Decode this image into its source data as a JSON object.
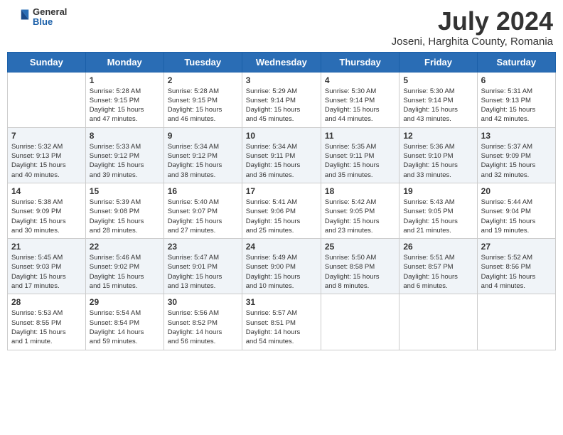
{
  "header": {
    "logo_general": "General",
    "logo_blue": "Blue",
    "month_year": "July 2024",
    "location": "Joseni, Harghita County, Romania"
  },
  "weekdays": [
    "Sunday",
    "Monday",
    "Tuesday",
    "Wednesday",
    "Thursday",
    "Friday",
    "Saturday"
  ],
  "weeks": [
    [
      {
        "day": "",
        "content": ""
      },
      {
        "day": "1",
        "content": "Sunrise: 5:28 AM\nSunset: 9:15 PM\nDaylight: 15 hours\nand 47 minutes."
      },
      {
        "day": "2",
        "content": "Sunrise: 5:28 AM\nSunset: 9:15 PM\nDaylight: 15 hours\nand 46 minutes."
      },
      {
        "day": "3",
        "content": "Sunrise: 5:29 AM\nSunset: 9:14 PM\nDaylight: 15 hours\nand 45 minutes."
      },
      {
        "day": "4",
        "content": "Sunrise: 5:30 AM\nSunset: 9:14 PM\nDaylight: 15 hours\nand 44 minutes."
      },
      {
        "day": "5",
        "content": "Sunrise: 5:30 AM\nSunset: 9:14 PM\nDaylight: 15 hours\nand 43 minutes."
      },
      {
        "day": "6",
        "content": "Sunrise: 5:31 AM\nSunset: 9:13 PM\nDaylight: 15 hours\nand 42 minutes."
      }
    ],
    [
      {
        "day": "7",
        "content": "Sunrise: 5:32 AM\nSunset: 9:13 PM\nDaylight: 15 hours\nand 40 minutes."
      },
      {
        "day": "8",
        "content": "Sunrise: 5:33 AM\nSunset: 9:12 PM\nDaylight: 15 hours\nand 39 minutes."
      },
      {
        "day": "9",
        "content": "Sunrise: 5:34 AM\nSunset: 9:12 PM\nDaylight: 15 hours\nand 38 minutes."
      },
      {
        "day": "10",
        "content": "Sunrise: 5:34 AM\nSunset: 9:11 PM\nDaylight: 15 hours\nand 36 minutes."
      },
      {
        "day": "11",
        "content": "Sunrise: 5:35 AM\nSunset: 9:11 PM\nDaylight: 15 hours\nand 35 minutes."
      },
      {
        "day": "12",
        "content": "Sunrise: 5:36 AM\nSunset: 9:10 PM\nDaylight: 15 hours\nand 33 minutes."
      },
      {
        "day": "13",
        "content": "Sunrise: 5:37 AM\nSunset: 9:09 PM\nDaylight: 15 hours\nand 32 minutes."
      }
    ],
    [
      {
        "day": "14",
        "content": "Sunrise: 5:38 AM\nSunset: 9:09 PM\nDaylight: 15 hours\nand 30 minutes."
      },
      {
        "day": "15",
        "content": "Sunrise: 5:39 AM\nSunset: 9:08 PM\nDaylight: 15 hours\nand 28 minutes."
      },
      {
        "day": "16",
        "content": "Sunrise: 5:40 AM\nSunset: 9:07 PM\nDaylight: 15 hours\nand 27 minutes."
      },
      {
        "day": "17",
        "content": "Sunrise: 5:41 AM\nSunset: 9:06 PM\nDaylight: 15 hours\nand 25 minutes."
      },
      {
        "day": "18",
        "content": "Sunrise: 5:42 AM\nSunset: 9:05 PM\nDaylight: 15 hours\nand 23 minutes."
      },
      {
        "day": "19",
        "content": "Sunrise: 5:43 AM\nSunset: 9:05 PM\nDaylight: 15 hours\nand 21 minutes."
      },
      {
        "day": "20",
        "content": "Sunrise: 5:44 AM\nSunset: 9:04 PM\nDaylight: 15 hours\nand 19 minutes."
      }
    ],
    [
      {
        "day": "21",
        "content": "Sunrise: 5:45 AM\nSunset: 9:03 PM\nDaylight: 15 hours\nand 17 minutes."
      },
      {
        "day": "22",
        "content": "Sunrise: 5:46 AM\nSunset: 9:02 PM\nDaylight: 15 hours\nand 15 minutes."
      },
      {
        "day": "23",
        "content": "Sunrise: 5:47 AM\nSunset: 9:01 PM\nDaylight: 15 hours\nand 13 minutes."
      },
      {
        "day": "24",
        "content": "Sunrise: 5:49 AM\nSunset: 9:00 PM\nDaylight: 15 hours\nand 10 minutes."
      },
      {
        "day": "25",
        "content": "Sunrise: 5:50 AM\nSunset: 8:58 PM\nDaylight: 15 hours\nand 8 minutes."
      },
      {
        "day": "26",
        "content": "Sunrise: 5:51 AM\nSunset: 8:57 PM\nDaylight: 15 hours\nand 6 minutes."
      },
      {
        "day": "27",
        "content": "Sunrise: 5:52 AM\nSunset: 8:56 PM\nDaylight: 15 hours\nand 4 minutes."
      }
    ],
    [
      {
        "day": "28",
        "content": "Sunrise: 5:53 AM\nSunset: 8:55 PM\nDaylight: 15 hours\nand 1 minute."
      },
      {
        "day": "29",
        "content": "Sunrise: 5:54 AM\nSunset: 8:54 PM\nDaylight: 14 hours\nand 59 minutes."
      },
      {
        "day": "30",
        "content": "Sunrise: 5:56 AM\nSunset: 8:52 PM\nDaylight: 14 hours\nand 56 minutes."
      },
      {
        "day": "31",
        "content": "Sunrise: 5:57 AM\nSunset: 8:51 PM\nDaylight: 14 hours\nand 54 minutes."
      },
      {
        "day": "",
        "content": ""
      },
      {
        "day": "",
        "content": ""
      },
      {
        "day": "",
        "content": ""
      }
    ]
  ]
}
